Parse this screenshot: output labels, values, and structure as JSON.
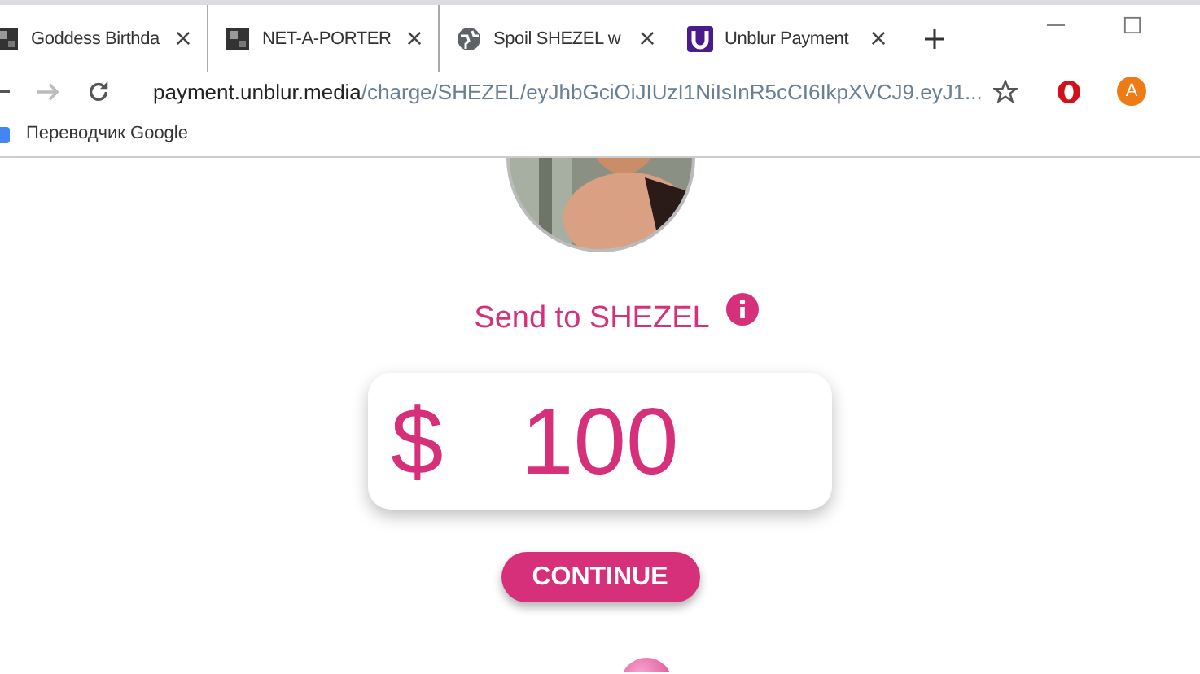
{
  "tabs": [
    {
      "title": "Goddess Birthda",
      "kind": "square"
    },
    {
      "title": "NET-A-PORTER",
      "kind": "square"
    },
    {
      "title": "Spoil SHEZEL w",
      "kind": "globe"
    },
    {
      "title": "Unblur Payment",
      "kind": "u"
    }
  ],
  "address": {
    "host": "payment.unblur.media",
    "path": "/charge/SHEZEL/eyJhbGciOiJIUzI1NiIsInR5cCI6IkpXVCJ9.eyJ1..."
  },
  "profile": {
    "initial": "A"
  },
  "bookmarks": [
    {
      "title": "Переводчик Google"
    }
  ],
  "page": {
    "recipient": "Send to SHEZEL",
    "currency": "$",
    "amount": "100",
    "button": "CONTINUE"
  }
}
